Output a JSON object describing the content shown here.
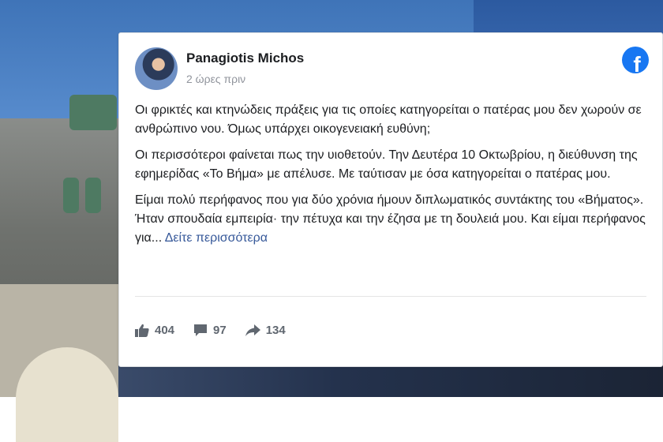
{
  "post": {
    "author": "Panagiotis Michos",
    "timestamp": "2 ώρες πριν",
    "paragraphs": [
      "Οι φρικτές και κτηνώδεις πράξεις για τις οποίες κατηγορείται ο πατέρας μου δεν χωρούν σε ανθρώπινο νου. Όμως υπάρχει οικογενειακή ευθύνη;",
      "Οι περισσότεροι φαίνεται πως την υιοθετούν. Την Δευτέρα 10 Οκτωβρίου, η διεύθυνση της εφημερίδας «Το Βήμα» με απέλυσε. Με ταύτισαν με όσα κατηγορείται ο πατέρας μου.",
      "Είμαι πολύ περήφανος που για δύο χρόνια ήμουν διπλωματικός συντάκτης του «Βήματος». Ήταν σπουδαία εμπειρία· την πέτυχα και την έζησα με τη δουλειά μου. Και είμαι περήφανος για..."
    ],
    "see_more": "Δείτε περισσότερα",
    "likes": "404",
    "comments": "97",
    "shares": "134",
    "brand_icon": "facebook-icon",
    "brand_color": "#1877f2"
  }
}
